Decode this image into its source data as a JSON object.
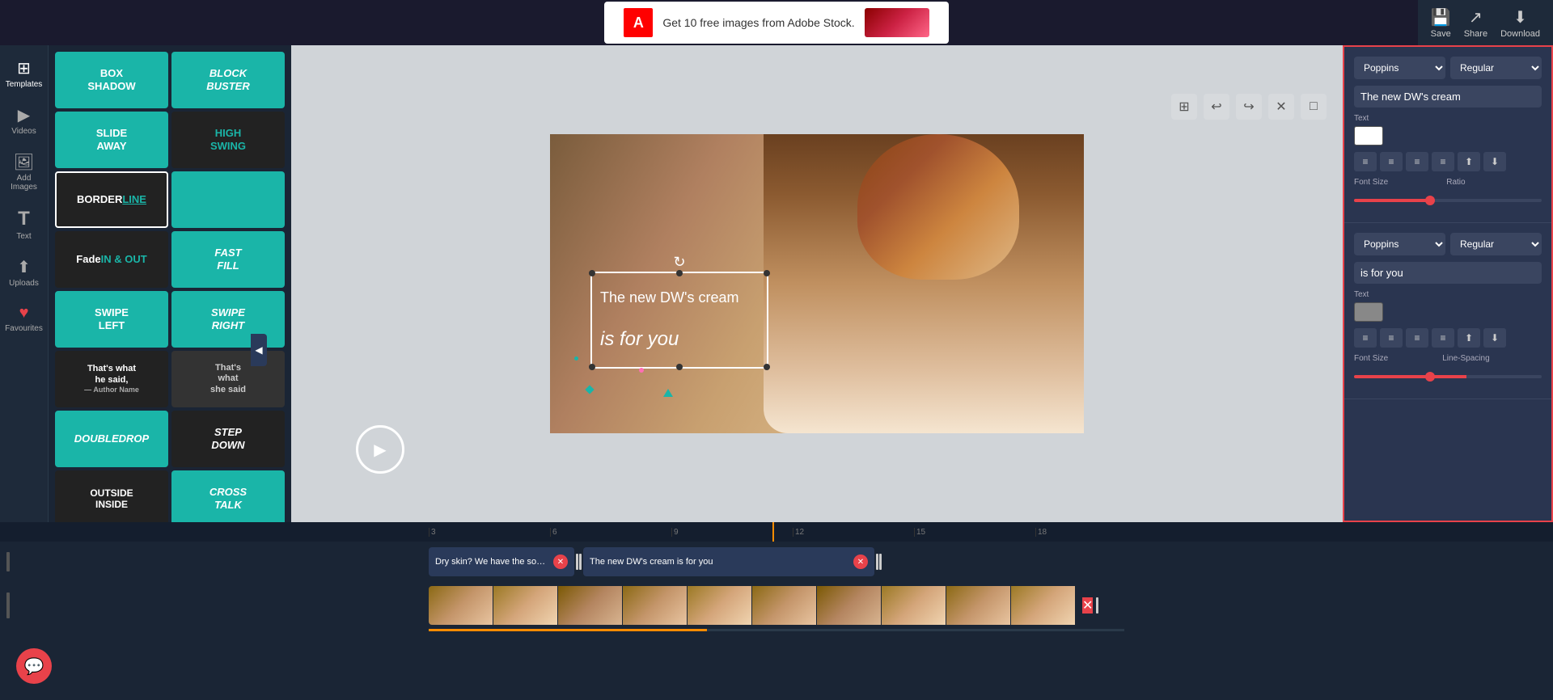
{
  "ad": {
    "logo": "A",
    "text": "Get 10 free images from Adobe Stock.",
    "cta": ""
  },
  "toolbar": {
    "save_label": "Save",
    "share_label": "Share",
    "download_label": "Download"
  },
  "sidebar": {
    "items": [
      {
        "id": "templates",
        "label": "Templates",
        "icon": "⊞"
      },
      {
        "id": "videos",
        "label": "Videos",
        "icon": "▶"
      },
      {
        "id": "add-images",
        "label": "Add Images",
        "icon": "🖼"
      },
      {
        "id": "text",
        "label": "Text",
        "icon": "T"
      },
      {
        "id": "uploads",
        "label": "Uploads",
        "icon": "↑"
      },
      {
        "id": "favourites",
        "label": "Favourites",
        "icon": "♥"
      }
    ]
  },
  "templates": {
    "cards": [
      {
        "id": "box-shadow",
        "label": "BOX SHADOW",
        "bg": "#1ab5a8",
        "color": "#fff",
        "size": "half"
      },
      {
        "id": "block-buster",
        "label": "BLOCK BUSTER",
        "bg": "#1ab5a8",
        "color": "#fff",
        "italic": true,
        "size": "half"
      },
      {
        "id": "slide-away",
        "label": "SLIDE AWAY",
        "bg": "#1ab5a8",
        "color": "#fff",
        "size": "half"
      },
      {
        "id": "high-swing",
        "label": "HIGH SWING",
        "bg": "#222",
        "color": "#1ab5a8",
        "size": "half"
      },
      {
        "id": "border-line",
        "label": "BORDER LINE",
        "bg": "#222",
        "color": "#fff",
        "size": "half"
      },
      {
        "id": "color-block",
        "label": "",
        "bg": "#1ab5a8",
        "color": "#fff",
        "size": "half"
      },
      {
        "id": "fade-in-out",
        "label": "Fade IN & OUT",
        "bg": "#222",
        "color": "#1ab5a8",
        "size": "half"
      },
      {
        "id": "fast-fill",
        "label": "FAST FILL",
        "bg": "#1ab5a8",
        "color": "#fff",
        "italic": true,
        "size": "half"
      },
      {
        "id": "swipe-left",
        "label": "SWIPE LEFT",
        "bg": "#1ab5a8",
        "color": "#fff",
        "size": "half"
      },
      {
        "id": "swipe-right",
        "label": "SWIPE RIGHT",
        "bg": "#1ab5a8",
        "color": "#fff",
        "italic": true,
        "size": "half"
      },
      {
        "id": "thats-what-he-said",
        "label": "That's what he said\n— Author Name",
        "bg": "#222",
        "color": "#fff",
        "size": "half"
      },
      {
        "id": "thats-what-she-said",
        "label": "That's what she said",
        "bg": "#333",
        "color": "#ccc",
        "size": "half"
      },
      {
        "id": "double-drop",
        "label": "DOUBLE DROP",
        "bg": "#1ab5a8",
        "color": "#fff",
        "size": "half"
      },
      {
        "id": "step-down",
        "label": "STEP DOWN",
        "bg": "#222",
        "color": "#fff",
        "italic": true,
        "size": "half"
      },
      {
        "id": "outside-inside",
        "label": "OUTSIDE INSIDE",
        "bg": "#222",
        "color": "#fff",
        "size": "half"
      },
      {
        "id": "cross-talk",
        "label": "CROSS TALK",
        "bg": "#1ab5a8",
        "color": "#fff",
        "italic": true,
        "size": "half"
      }
    ]
  },
  "canvas": {
    "toolbar_buttons": [
      "grid",
      "undo",
      "redo",
      "close",
      "expand"
    ],
    "overlay_text_1": "The new DW's cream",
    "overlay_text_2": "is for you"
  },
  "right_panel": {
    "block1": {
      "font": "Poppins",
      "style": "Regular",
      "text": "The new DW's cream",
      "color": "#ffffff",
      "font_size_label": "Font Size",
      "ratio_label": "Ratio"
    },
    "block2": {
      "font": "Poppins",
      "style": "Regular",
      "text": "is for you",
      "color": "#888888",
      "font_size_label": "Font Size",
      "line_spacing_label": "Line-Spacing"
    }
  },
  "timeline": {
    "ruler_marks": [
      "3",
      "6",
      "9",
      "12",
      "15",
      "18"
    ],
    "caption_segments": [
      {
        "text": "Dry skin? We have the solu...",
        "color": "#2a3a5a"
      },
      {
        "text": "The new DW's cream is for you",
        "color": "#2a3a5a"
      }
    ],
    "progress_percent": 40
  }
}
